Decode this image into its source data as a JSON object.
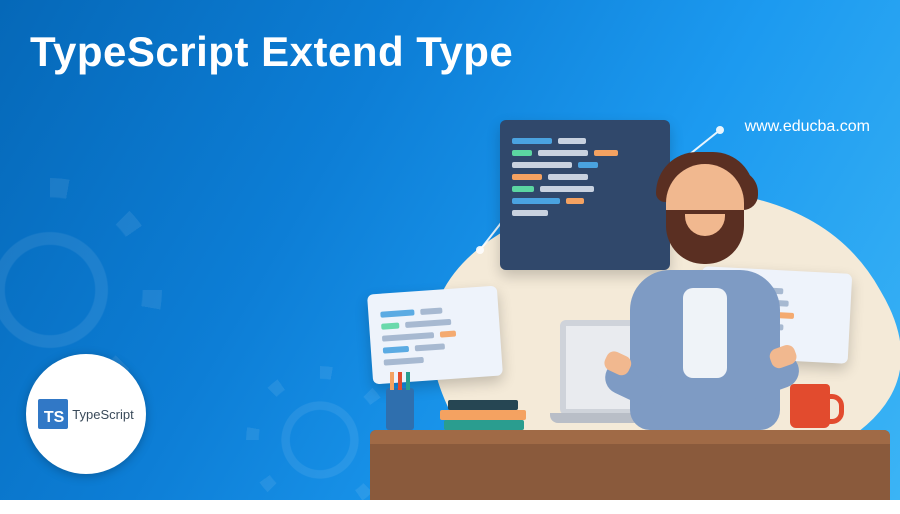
{
  "title": "TypeScript Extend Type",
  "site_url": "www.educba.com",
  "logo": {
    "mark": "TS",
    "word": "TypeScript"
  },
  "colors": {
    "code_bg_dark": "#30486b",
    "code_bg_light": "#eef3fb",
    "seg_blue": "#4aa3e0",
    "seg_orange": "#f4a261",
    "seg_green": "#5bd6a2",
    "seg_grey": "#c8d2e0"
  }
}
